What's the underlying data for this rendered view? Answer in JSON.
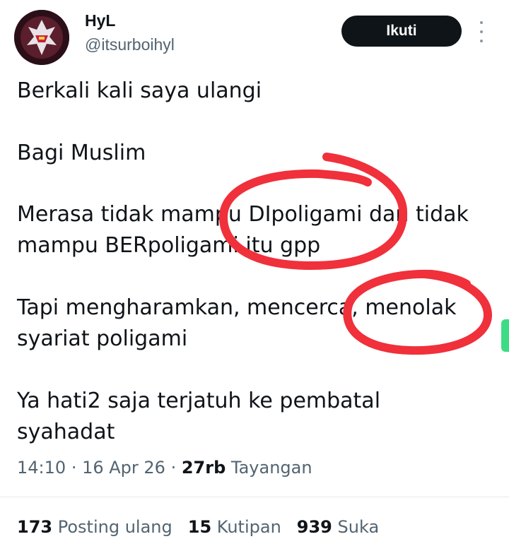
{
  "author": {
    "display_name": "HyL",
    "handle": "@itsurboihyl"
  },
  "actions": {
    "follow_label": "Ikuti",
    "more_icon": "more-vertical-icon"
  },
  "tweet": {
    "lines": [
      "Berkali kali saya ulangi",
      "Bagi Muslim",
      "Merasa tidak mampu DIpoligami dan tidak",
      "mampu BERpoligami itu gpp",
      "Tapi mengharamkan, mencerca, menolak",
      "syariat poligami",
      "Ya hati2 saja terjatuh ke pembatal",
      "syahadat"
    ]
  },
  "meta": {
    "time": "14:10",
    "date": "16 Apr 26",
    "views_count": "27rb",
    "views_label": "Tayangan"
  },
  "stats": {
    "reposts_count": "173",
    "reposts_label": "Posting ulang",
    "quotes_count": "15",
    "quotes_label": "Kutipan",
    "likes_count": "939",
    "likes_label": "Suka"
  },
  "colors": {
    "text": "#0f1419",
    "secondary": "#536471",
    "button_bg": "#0f1419",
    "annotation_red": "#f0303a",
    "scroll_tab": "#3ddc84"
  }
}
